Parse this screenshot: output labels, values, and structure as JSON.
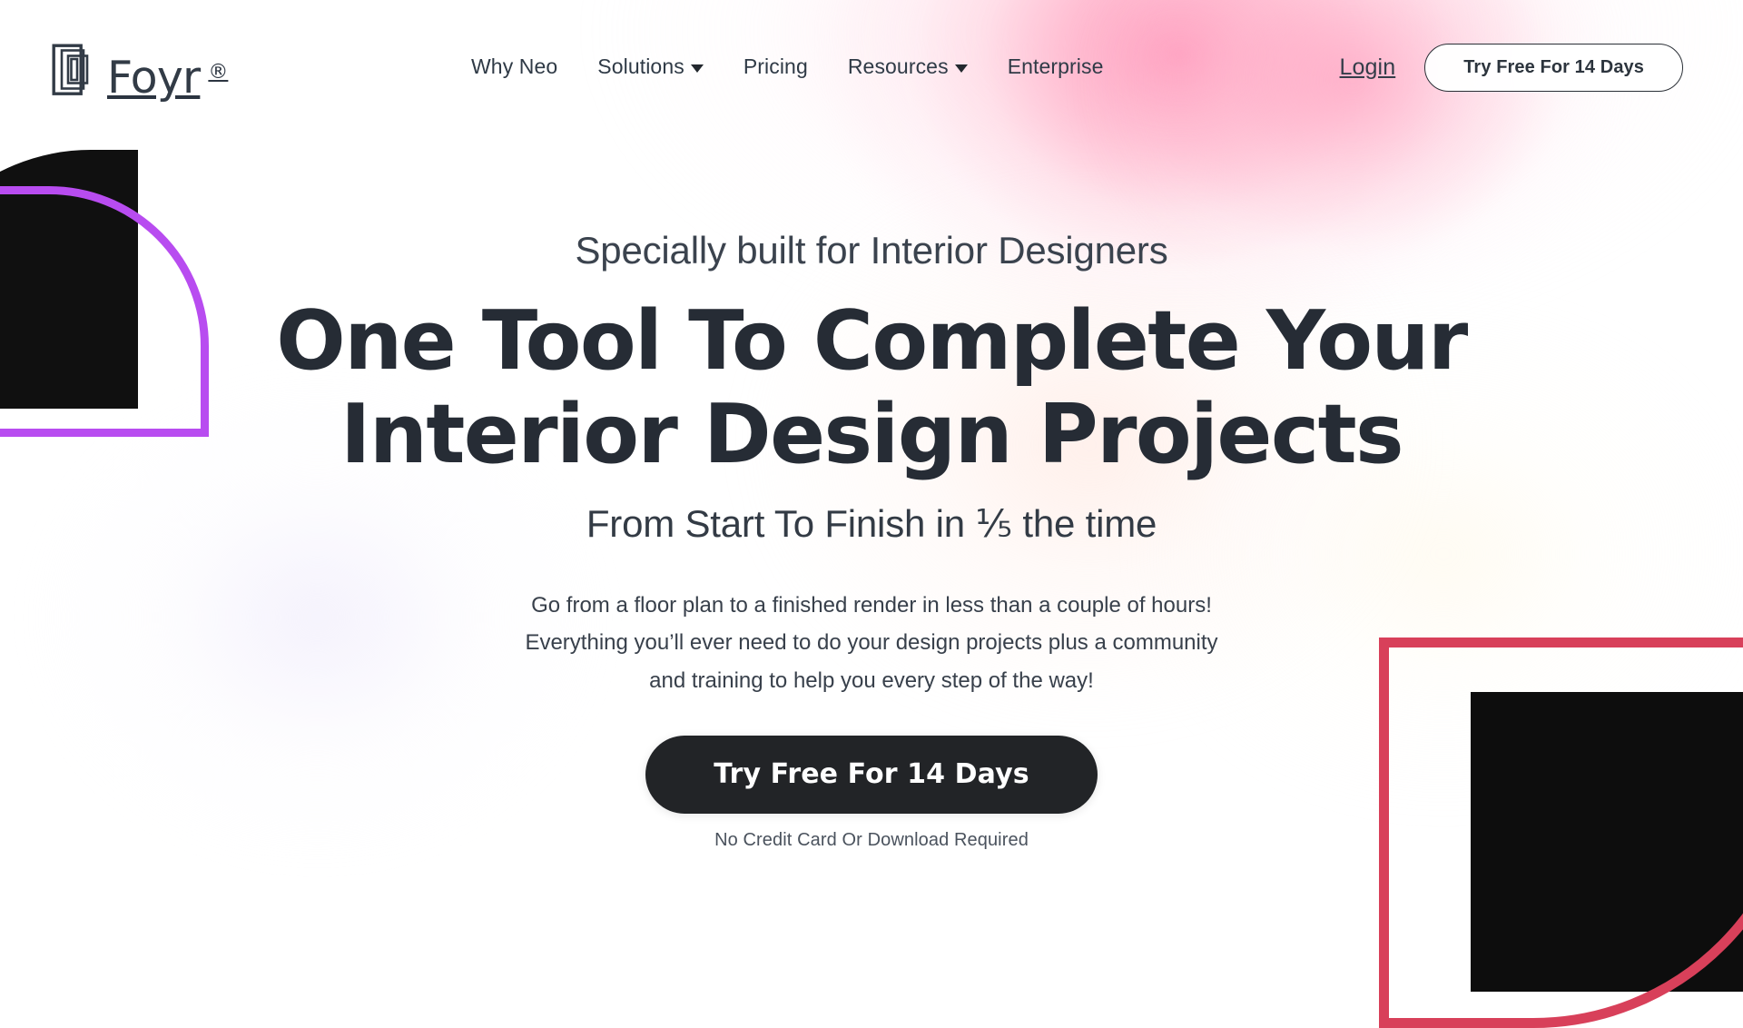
{
  "brand": {
    "name": "Foyr",
    "registered_mark": "®",
    "logo_icon": "foyr-overlapping-squares-logo"
  },
  "header": {
    "nav_items": [
      {
        "label": "Why Neo",
        "has_dropdown": false
      },
      {
        "label": "Solutions",
        "has_dropdown": true
      },
      {
        "label": "Pricing",
        "has_dropdown": false
      },
      {
        "label": "Resources",
        "has_dropdown": true
      },
      {
        "label": "Enterprise",
        "has_dropdown": false
      }
    ],
    "login_label": "Login",
    "cta_label": "Try Free For 14 Days"
  },
  "hero": {
    "eyebrow": "Specially built for Interior Designers",
    "title_line1": "One Tool To Complete Your",
    "title_line2": "Interior Design Projects",
    "subtitle": "From Start To Finish in ⅕ the time",
    "paragraph": "Go from a floor plan to a finished render in less than a couple of hours! Everything you’ll ever need to do your design projects plus a community and training to help you every step of the way!",
    "cta_label": "Try Free For 14 Days",
    "note": "No Credit Card Or Download Required"
  },
  "colors": {
    "ink": "#262c35",
    "body_text": "#38404b",
    "cta_dark": "#222427",
    "accent_purple": "#b84cf0",
    "accent_red": "#d8405a",
    "shape_black": "#101010",
    "blob_pink": "#ff96b9",
    "page_bg": "#ffffff"
  }
}
